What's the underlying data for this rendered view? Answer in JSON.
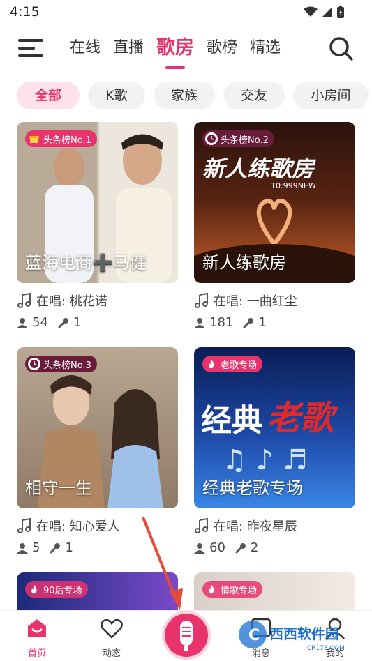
{
  "status_bar": {
    "time": "4:15"
  },
  "top_nav": {
    "tabs": [
      {
        "label": "在线"
      },
      {
        "label": "直播"
      },
      {
        "label": "歌房",
        "active": true
      },
      {
        "label": "歌榜"
      },
      {
        "label": "精选"
      }
    ]
  },
  "filter_chips": [
    {
      "label": "全部",
      "active": true
    },
    {
      "label": "K歌"
    },
    {
      "label": "家族"
    },
    {
      "label": "交友"
    },
    {
      "label": "小房间"
    }
  ],
  "rooms": [
    {
      "badge": "头条榜No.1",
      "badge_color": "#e8336d",
      "title": "蓝海电商➕马健",
      "singing": "在唱: 桃花诺",
      "listeners": "54",
      "mics": "1",
      "cover_colors": [
        "#9c8b78",
        "#d8cfc1"
      ]
    },
    {
      "badge": "头条榜No.2",
      "badge_color": "#6a1b3a",
      "title": "新人练歌房",
      "singing": "在唱: 一曲红尘",
      "listeners": "181",
      "mics": "1",
      "cover_colors": [
        "#3a1a12",
        "#c8602a"
      ]
    },
    {
      "badge": "头条榜No.3",
      "badge_color": "#6a1b3a",
      "title": "相守一生",
      "singing": "在唱: 知心爱人",
      "listeners": "5",
      "mics": "1",
      "cover_colors": [
        "#8b6d58",
        "#cdb8a4"
      ]
    },
    {
      "badge": "老歌专场",
      "badge_color": "#e8336d",
      "title": "经典老歌专场",
      "singing": "在唱: 昨夜星辰",
      "listeners": "60",
      "mics": "2",
      "cover_colors": [
        "#0d2a6b",
        "#2d6fd1"
      ],
      "cover_text": [
        "经典",
        "老歌"
      ]
    },
    {
      "badge": "90后专场",
      "badge_color": "#e8336d",
      "title": "",
      "cover_colors": [
        "#1a2a7a",
        "#7a4ac8"
      ]
    },
    {
      "badge": "情歌专场",
      "badge_color": "#e8336d",
      "title": "",
      "cover_colors": [
        "#d9cfc8",
        "#f2ebe6"
      ]
    }
  ],
  "poster": {
    "new_room_text": "新人练歌房",
    "new_room_sub": "10:999NEW"
  },
  "bottom_nav": {
    "items": [
      {
        "label": "首页",
        "active": true
      },
      {
        "label": "动态"
      },
      {
        "label": "消息"
      },
      {
        "label": "我的"
      }
    ]
  },
  "watermark": {
    "text": "西西软件园",
    "sub": "CR173.COM"
  },
  "colors": {
    "accent": "#e8336d",
    "chip_bg": "#f2f2f2",
    "chip_active_bg": "#fde2ea"
  }
}
